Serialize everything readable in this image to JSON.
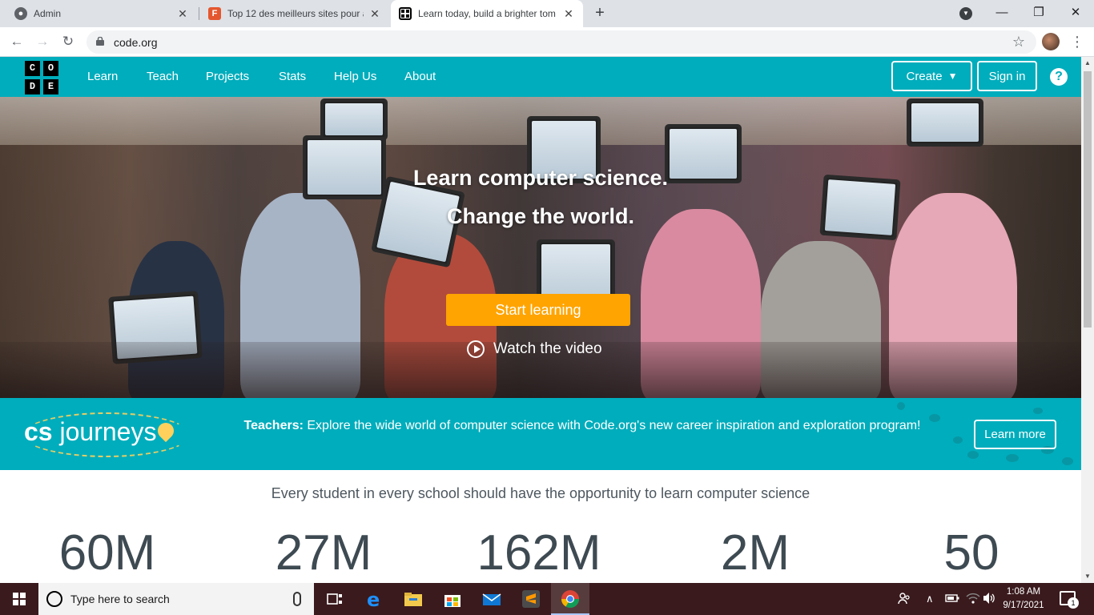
{
  "browser": {
    "tabs": [
      {
        "label": "Admin",
        "favicon": "globe-icon"
      },
      {
        "label": "Top 12 des meilleurs sites pour ap",
        "favicon": "f-favicon-icon"
      },
      {
        "label": "Learn today, build a brighter tom",
        "favicon": "code-org-favicon-icon",
        "active": true
      }
    ],
    "url": "code.org",
    "window_controls": {
      "minimize": "—",
      "maximize": "❐",
      "close": "✕"
    }
  },
  "site": {
    "logo_letters": [
      "C",
      "O",
      "D",
      "E"
    ],
    "nav": [
      "Learn",
      "Teach",
      "Projects",
      "Stats",
      "Help Us",
      "About"
    ],
    "create_label": "Create",
    "signin_label": "Sign in",
    "help_label": "?",
    "brand_color": "#00adbc",
    "accent_color": "#ffa400"
  },
  "hero": {
    "title_line1": "Learn computer science.",
    "title_line2": "Change the world.",
    "start_label": "Start learning",
    "video_label": "Watch the video"
  },
  "banner": {
    "logo_cs": "cs",
    "logo_word": "journeys",
    "teachers_label": "Teachers:",
    "text": "Explore the wide world of computer science with Code.org's new career inspiration and exploration program!",
    "button_label": "Learn more"
  },
  "stats": {
    "tagline": "Every student in every school should have the opportunity to learn computer science",
    "values": [
      "60M",
      "27M",
      "162M",
      "2M",
      "50"
    ]
  },
  "taskbar": {
    "search_placeholder": "Type here to search",
    "time": "1:08 AM",
    "date": "9/17/2021",
    "notification_count": "1"
  }
}
